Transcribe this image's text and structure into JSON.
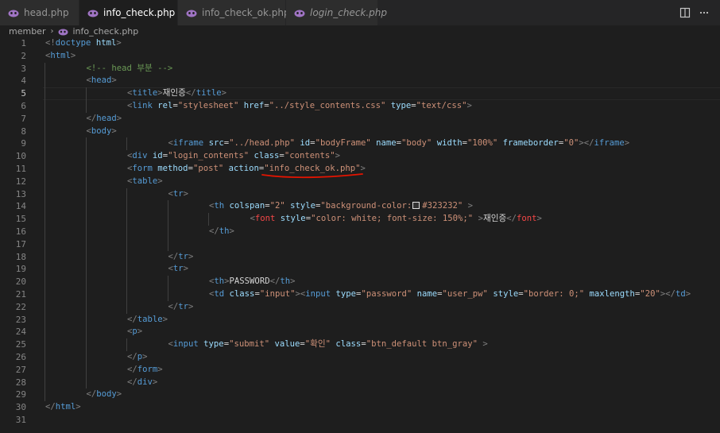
{
  "tabs": [
    {
      "label": "head.php",
      "active": false,
      "italic": false,
      "state": "none"
    },
    {
      "label": "info_check.php",
      "active": true,
      "italic": false,
      "state": "close"
    },
    {
      "label": "info_check_ok.php",
      "active": false,
      "italic": false,
      "state": "dirty"
    },
    {
      "label": "login_check.php",
      "active": false,
      "italic": true,
      "state": "none"
    }
  ],
  "breadcrumb": {
    "folder": "member",
    "file": "info_check.php"
  },
  "current_line": 5,
  "colors": {
    "php_icon": "#a074c4",
    "annotation": "#e51400",
    "accent": "#569cd6"
  },
  "lines": [
    {
      "n": "1",
      "indent": 0,
      "tokens": [
        [
          "punc",
          "<!"
        ],
        [
          "tag",
          "doctype"
        ],
        [
          "txt",
          " "
        ],
        [
          "attr",
          "html"
        ],
        [
          "punc",
          ">"
        ]
      ]
    },
    {
      "n": "2",
      "indent": 0,
      "tokens": [
        [
          "punc",
          "<"
        ],
        [
          "tag",
          "html"
        ],
        [
          "punc",
          ">"
        ]
      ]
    },
    {
      "n": "3",
      "indent": 1,
      "tokens": [
        [
          "com",
          "<!-- head 부분 -->"
        ]
      ]
    },
    {
      "n": "4",
      "indent": 1,
      "tokens": [
        [
          "punc",
          "<"
        ],
        [
          "tag",
          "head"
        ],
        [
          "punc",
          ">"
        ]
      ]
    },
    {
      "n": "5",
      "indent": 2,
      "tokens": [
        [
          "punc",
          "<"
        ],
        [
          "tag",
          "title"
        ],
        [
          "punc",
          ">"
        ],
        [
          "txt",
          "재인증"
        ],
        [
          "punc",
          "</"
        ],
        [
          "tag",
          "title"
        ],
        [
          "punc",
          ">"
        ]
      ]
    },
    {
      "n": "6",
      "indent": 2,
      "tokens": [
        [
          "punc",
          "<"
        ],
        [
          "tag",
          "link"
        ],
        [
          "txt",
          " "
        ],
        [
          "attr",
          "rel"
        ],
        [
          "txt",
          "="
        ],
        [
          "str",
          "\"stylesheet\""
        ],
        [
          "txt",
          " "
        ],
        [
          "attr",
          "href"
        ],
        [
          "txt",
          "="
        ],
        [
          "str",
          "\"../style_contents.css\""
        ],
        [
          "txt",
          " "
        ],
        [
          "attr",
          "type"
        ],
        [
          "txt",
          "="
        ],
        [
          "str",
          "\"text/css\""
        ],
        [
          "punc",
          ">"
        ]
      ]
    },
    {
      "n": "7",
      "indent": 1,
      "tokens": [
        [
          "punc",
          "</"
        ],
        [
          "tag",
          "head"
        ],
        [
          "punc",
          ">"
        ]
      ]
    },
    {
      "n": "8",
      "indent": 1,
      "tokens": [
        [
          "punc",
          "<"
        ],
        [
          "tag",
          "body"
        ],
        [
          "punc",
          ">"
        ]
      ]
    },
    {
      "n": "9",
      "indent": 3,
      "tokens": [
        [
          "punc",
          "<"
        ],
        [
          "tag",
          "iframe"
        ],
        [
          "txt",
          " "
        ],
        [
          "attr",
          "src"
        ],
        [
          "txt",
          "="
        ],
        [
          "str",
          "\"../head.php\""
        ],
        [
          "txt",
          " "
        ],
        [
          "attr",
          "id"
        ],
        [
          "txt",
          "="
        ],
        [
          "str",
          "\"bodyFrame\""
        ],
        [
          "txt",
          " "
        ],
        [
          "attr",
          "name"
        ],
        [
          "txt",
          "="
        ],
        [
          "str",
          "\"body\""
        ],
        [
          "txt",
          " "
        ],
        [
          "attr",
          "width"
        ],
        [
          "txt",
          "="
        ],
        [
          "str",
          "\"100%\""
        ],
        [
          "txt",
          " "
        ],
        [
          "attr",
          "frameborder"
        ],
        [
          "txt",
          "="
        ],
        [
          "str",
          "\"0\""
        ],
        [
          "punc",
          "></"
        ],
        [
          "tag",
          "iframe"
        ],
        [
          "punc",
          ">"
        ]
      ]
    },
    {
      "n": "10",
      "indent": 2,
      "tokens": [
        [
          "punc",
          "<"
        ],
        [
          "tag",
          "div"
        ],
        [
          "txt",
          " "
        ],
        [
          "attr",
          "id"
        ],
        [
          "txt",
          "="
        ],
        [
          "str",
          "\"login_contents\""
        ],
        [
          "txt",
          " "
        ],
        [
          "attr",
          "class"
        ],
        [
          "txt",
          "="
        ],
        [
          "str",
          "\"contents\""
        ],
        [
          "punc",
          ">"
        ]
      ]
    },
    {
      "n": "11",
      "indent": 2,
      "tokens": [
        [
          "punc",
          "<"
        ],
        [
          "tag",
          "form"
        ],
        [
          "txt",
          " "
        ],
        [
          "attr",
          "method"
        ],
        [
          "txt",
          "="
        ],
        [
          "str",
          "\"post\""
        ],
        [
          "txt",
          " "
        ],
        [
          "attr",
          "action"
        ],
        [
          "txt",
          "="
        ],
        [
          "str",
          "\"info_check_ok.php\""
        ],
        [
          "punc",
          ">"
        ]
      ]
    },
    {
      "n": "12",
      "indent": 2,
      "tokens": [
        [
          "punc",
          "<"
        ],
        [
          "tag",
          "table"
        ],
        [
          "punc",
          ">"
        ]
      ]
    },
    {
      "n": "13",
      "indent": 3,
      "tokens": [
        [
          "punc",
          "<"
        ],
        [
          "tag",
          "tr"
        ],
        [
          "punc",
          ">"
        ]
      ]
    },
    {
      "n": "14",
      "indent": 4,
      "tokens": [
        [
          "punc",
          "<"
        ],
        [
          "tag",
          "th"
        ],
        [
          "txt",
          " "
        ],
        [
          "attr",
          "colspan"
        ],
        [
          "txt",
          "="
        ],
        [
          "str",
          "\"2\""
        ],
        [
          "txt",
          " "
        ],
        [
          "attr",
          "style"
        ],
        [
          "txt",
          "="
        ],
        [
          "str",
          "\"background-color:"
        ],
        [
          "box",
          ""
        ],
        [
          "str",
          "#323232\""
        ],
        [
          "txt",
          " "
        ],
        [
          "punc",
          ">"
        ]
      ]
    },
    {
      "n": "15",
      "indent": 5,
      "tokens": [
        [
          "punc",
          "<"
        ],
        [
          "font",
          "font"
        ],
        [
          "txt",
          " "
        ],
        [
          "attr",
          "style"
        ],
        [
          "txt",
          "="
        ],
        [
          "str",
          "\"color: white; font-size: 150%;\""
        ],
        [
          "txt",
          " "
        ],
        [
          "punc",
          ">"
        ],
        [
          "txt",
          "재인증"
        ],
        [
          "punc",
          "</"
        ],
        [
          "font",
          "font"
        ],
        [
          "punc",
          ">"
        ]
      ]
    },
    {
      "n": "16",
      "indent": 4,
      "tokens": [
        [
          "punc",
          "</"
        ],
        [
          "tag",
          "th"
        ],
        [
          "punc",
          ">"
        ]
      ]
    },
    {
      "n": "17",
      "indent": 4,
      "tokens": []
    },
    {
      "n": "18",
      "indent": 3,
      "tokens": [
        [
          "punc",
          "</"
        ],
        [
          "tag",
          "tr"
        ],
        [
          "punc",
          ">"
        ]
      ]
    },
    {
      "n": "19",
      "indent": 3,
      "tokens": [
        [
          "punc",
          "<"
        ],
        [
          "tag",
          "tr"
        ],
        [
          "punc",
          ">"
        ]
      ]
    },
    {
      "n": "20",
      "indent": 4,
      "tokens": [
        [
          "punc",
          "<"
        ],
        [
          "tag",
          "th"
        ],
        [
          "punc",
          ">"
        ],
        [
          "txt",
          "PASSWORD"
        ],
        [
          "punc",
          "</"
        ],
        [
          "tag",
          "th"
        ],
        [
          "punc",
          ">"
        ]
      ]
    },
    {
      "n": "21",
      "indent": 4,
      "tokens": [
        [
          "punc",
          "<"
        ],
        [
          "tag",
          "td"
        ],
        [
          "txt",
          " "
        ],
        [
          "attr",
          "class"
        ],
        [
          "txt",
          "="
        ],
        [
          "str",
          "\"input\""
        ],
        [
          "punc",
          "><"
        ],
        [
          "tag",
          "input"
        ],
        [
          "txt",
          " "
        ],
        [
          "attr",
          "type"
        ],
        [
          "txt",
          "="
        ],
        [
          "str",
          "\"password\""
        ],
        [
          "txt",
          " "
        ],
        [
          "attr",
          "name"
        ],
        [
          "txt",
          "="
        ],
        [
          "str",
          "\"user_pw\""
        ],
        [
          "txt",
          " "
        ],
        [
          "attr",
          "style"
        ],
        [
          "txt",
          "="
        ],
        [
          "str",
          "\"border: 0;\""
        ],
        [
          "txt",
          " "
        ],
        [
          "attr",
          "maxlength"
        ],
        [
          "txt",
          "="
        ],
        [
          "str",
          "\"20\""
        ],
        [
          "punc",
          "></"
        ],
        [
          "tag",
          "td"
        ],
        [
          "punc",
          ">"
        ]
      ]
    },
    {
      "n": "22",
      "indent": 3,
      "tokens": [
        [
          "punc",
          "</"
        ],
        [
          "tag",
          "tr"
        ],
        [
          "punc",
          ">"
        ]
      ]
    },
    {
      "n": "23",
      "indent": 2,
      "tokens": [
        [
          "punc",
          "</"
        ],
        [
          "tag",
          "table"
        ],
        [
          "punc",
          ">"
        ]
      ]
    },
    {
      "n": "24",
      "indent": 2,
      "tokens": [
        [
          "punc",
          "<"
        ],
        [
          "tag",
          "p"
        ],
        [
          "punc",
          ">"
        ]
      ]
    },
    {
      "n": "25",
      "indent": 3,
      "tokens": [
        [
          "punc",
          "<"
        ],
        [
          "tag",
          "input"
        ],
        [
          "txt",
          " "
        ],
        [
          "attr",
          "type"
        ],
        [
          "txt",
          "="
        ],
        [
          "str",
          "\"submit\""
        ],
        [
          "txt",
          " "
        ],
        [
          "attr",
          "value"
        ],
        [
          "txt",
          "="
        ],
        [
          "str",
          "\"확인\""
        ],
        [
          "txt",
          " "
        ],
        [
          "attr",
          "class"
        ],
        [
          "txt",
          "="
        ],
        [
          "str",
          "\"btn_default btn_gray\""
        ],
        [
          "txt",
          " "
        ],
        [
          "punc",
          ">"
        ]
      ]
    },
    {
      "n": "26",
      "indent": 2,
      "tokens": [
        [
          "punc",
          "</"
        ],
        [
          "tag",
          "p"
        ],
        [
          "punc",
          ">"
        ]
      ]
    },
    {
      "n": "27",
      "indent": 2,
      "tokens": [
        [
          "punc",
          "</"
        ],
        [
          "tag",
          "form"
        ],
        [
          "punc",
          ">"
        ]
      ]
    },
    {
      "n": "28",
      "indent": 2,
      "tokens": [
        [
          "punc",
          "</"
        ],
        [
          "tag",
          "div"
        ],
        [
          "punc",
          ">"
        ]
      ]
    },
    {
      "n": "29",
      "indent": 1,
      "tokens": [
        [
          "punc",
          "</"
        ],
        [
          "tag",
          "body"
        ],
        [
          "punc",
          ">"
        ]
      ]
    },
    {
      "n": "30",
      "indent": 0,
      "tokens": [
        [
          "punc",
          "</"
        ],
        [
          "tag",
          "html"
        ],
        [
          "punc",
          ">"
        ]
      ]
    },
    {
      "n": "31",
      "indent": 0,
      "tokens": []
    }
  ]
}
